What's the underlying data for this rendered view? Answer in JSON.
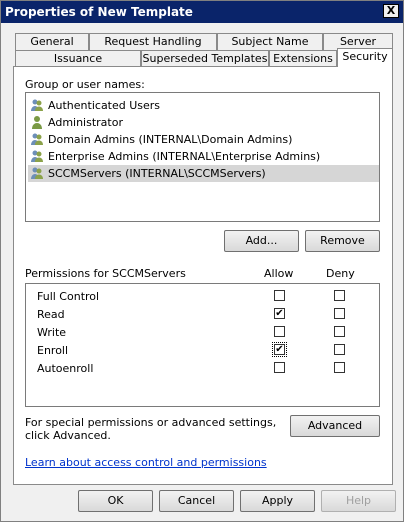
{
  "window": {
    "title": "Properties of New Template",
    "close_glyph": "X"
  },
  "tabs": {
    "row1": [
      "General",
      "Request Handling",
      "Subject Name",
      "Server"
    ],
    "row2": [
      "Issuance Requirements",
      "Superseded Templates",
      "Extensions",
      "Security"
    ],
    "active": "Security"
  },
  "group": {
    "label": "Group or user names:",
    "users": [
      "Authenticated Users",
      "Administrator",
      "Domain Admins (INTERNAL\\Domain Admins)",
      "Enterprise Admins (INTERNAL\\Enterprise Admins)",
      "SCCMServers (INTERNAL\\SCCMServers)"
    ],
    "selected_index": 4
  },
  "buttons": {
    "add": "Add...",
    "remove": "Remove",
    "advanced": "Advanced"
  },
  "permissions": {
    "label": "Permissions for SCCMServers",
    "allow_header": "Allow",
    "deny_header": "Deny",
    "rows": [
      {
        "name": "Full Control",
        "allow": false,
        "deny": false
      },
      {
        "name": "Read",
        "allow": true,
        "deny": false
      },
      {
        "name": "Write",
        "allow": false,
        "deny": false
      },
      {
        "name": "Enroll",
        "allow": true,
        "deny": false
      },
      {
        "name": "Autoenroll",
        "allow": false,
        "deny": false
      }
    ]
  },
  "special_text": "For special permissions or advanced settings, click Advanced.",
  "help_link": "Learn about access control and permissions",
  "footer": {
    "ok": "OK",
    "cancel": "Cancel",
    "apply": "Apply",
    "help": "Help"
  },
  "check_glyph": "✔"
}
